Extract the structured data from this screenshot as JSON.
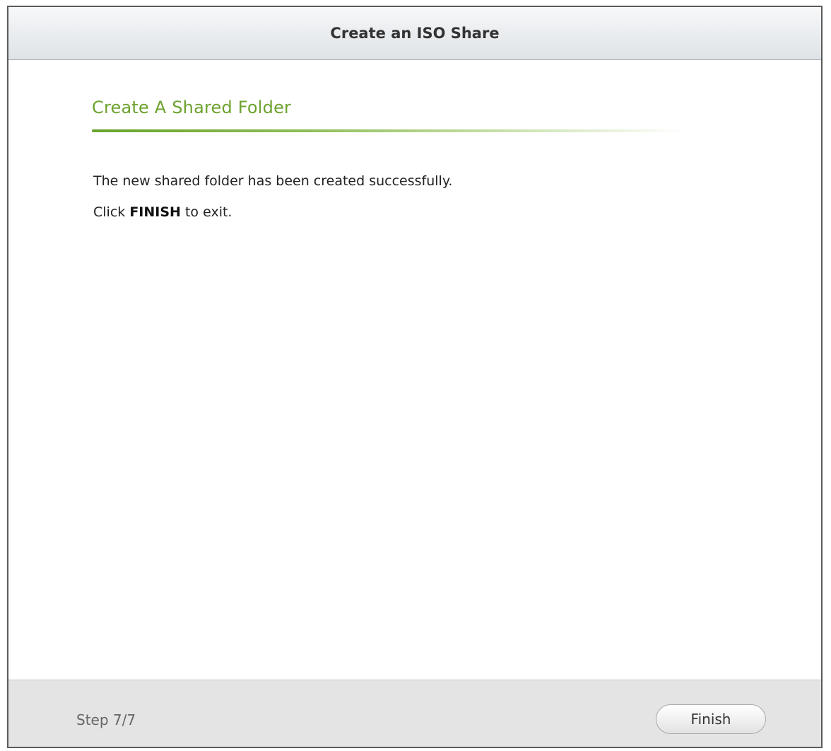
{
  "dialog": {
    "title": "Create an ISO Share"
  },
  "section": {
    "title": "Create A Shared Folder"
  },
  "message": {
    "line1": "The new shared folder has been created successfully.",
    "line2_prefix": "Click ",
    "line2_bold": "FINISH",
    "line2_suffix": " to exit."
  },
  "footer": {
    "step": "Step 7/7",
    "finish_label": "Finish"
  },
  "colors": {
    "accent_green": "#6da22e",
    "title_text": "#333333"
  }
}
